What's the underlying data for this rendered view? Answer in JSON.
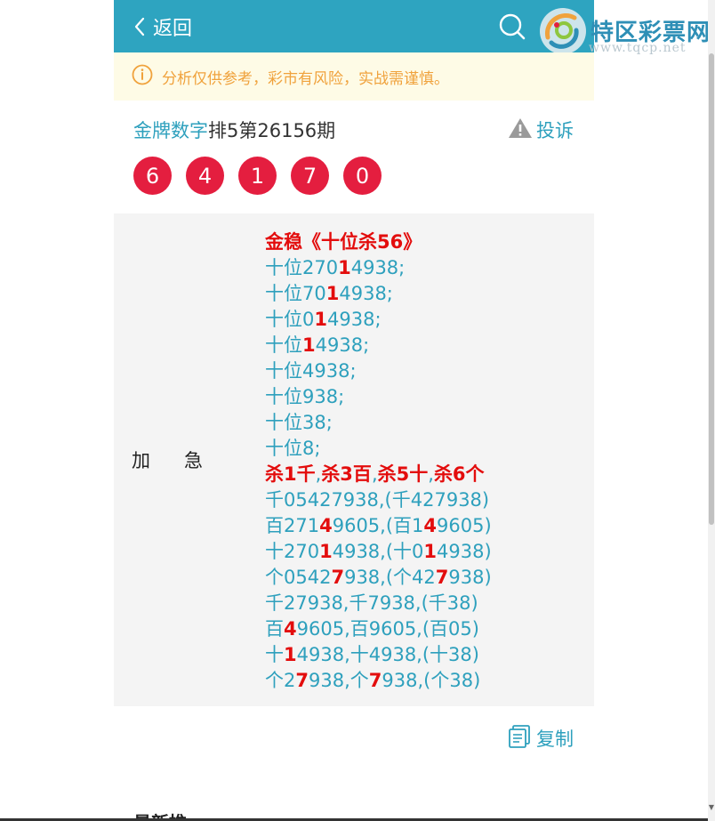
{
  "header": {
    "back_label": "返回",
    "bg_color": "#2ea4c0"
  },
  "logo": {
    "title": "特区彩票网",
    "url": "www.tqcp.net"
  },
  "notice": {
    "text": "分析仅供参考，彩市有风险，实战需谨慎。",
    "color": "#f0a23c",
    "icon": "info-circle-icon"
  },
  "post": {
    "expert_name": "金牌数字",
    "issue_text": "排5第26156期",
    "complain_label": "投诉",
    "balls": [
      "6",
      "4",
      "1",
      "7",
      "0"
    ],
    "ball_color": "#e41e3f",
    "label": "加急",
    "lines": [
      [
        {
          "t": "金稳《十位杀56》",
          "r": true
        }
      ],
      [
        {
          "t": "十位270"
        },
        {
          "t": "1",
          "r": true
        },
        {
          "t": "4938;"
        }
      ],
      [
        {
          "t": "十位70"
        },
        {
          "t": "1",
          "r": true
        },
        {
          "t": "4938;"
        }
      ],
      [
        {
          "t": "十位0"
        },
        {
          "t": "1",
          "r": true
        },
        {
          "t": "4938;"
        }
      ],
      [
        {
          "t": "十位"
        },
        {
          "t": "1",
          "r": true
        },
        {
          "t": "4938;"
        }
      ],
      [
        {
          "t": "十位4938;"
        }
      ],
      [
        {
          "t": "十位938;"
        }
      ],
      [
        {
          "t": "十位38;"
        }
      ],
      [
        {
          "t": "十位8;"
        }
      ],
      [
        {
          "t": "杀1千",
          "r": true
        },
        {
          "t": ","
        },
        {
          "t": "杀3百",
          "r": true
        },
        {
          "t": ","
        },
        {
          "t": "杀5十",
          "r": true
        },
        {
          "t": ","
        },
        {
          "t": "杀6个",
          "r": true
        }
      ],
      [
        {
          "t": "千05427938,(千427938)"
        }
      ],
      [
        {
          "t": "百271"
        },
        {
          "t": "4",
          "r": true
        },
        {
          "t": "9605,(百1"
        },
        {
          "t": "4",
          "r": true
        },
        {
          "t": "9605)"
        }
      ],
      [
        {
          "t": "十270"
        },
        {
          "t": "1",
          "r": true
        },
        {
          "t": "4938,(十0"
        },
        {
          "t": "1",
          "r": true
        },
        {
          "t": "4938)"
        }
      ],
      [
        {
          "t": "个0542"
        },
        {
          "t": "7",
          "r": true
        },
        {
          "t": "938,(个42"
        },
        {
          "t": "7",
          "r": true
        },
        {
          "t": "938)"
        }
      ],
      [
        {
          "t": "千27938,千7938,(千38)"
        }
      ],
      [
        {
          "t": "百"
        },
        {
          "t": "4",
          "r": true
        },
        {
          "t": "9605,百9605,(百05)"
        }
      ],
      [
        {
          "t": "十"
        },
        {
          "t": "1",
          "r": true
        },
        {
          "t": "4938,十4938,(十38)"
        }
      ],
      [
        {
          "t": "个2"
        },
        {
          "t": "7",
          "r": true
        },
        {
          "t": "938,个"
        },
        {
          "t": "7",
          "r": true
        },
        {
          "t": "938,(个38)"
        }
      ]
    ],
    "copy_label": "复制"
  },
  "next_section": {
    "peek_text": "最新推"
  }
}
